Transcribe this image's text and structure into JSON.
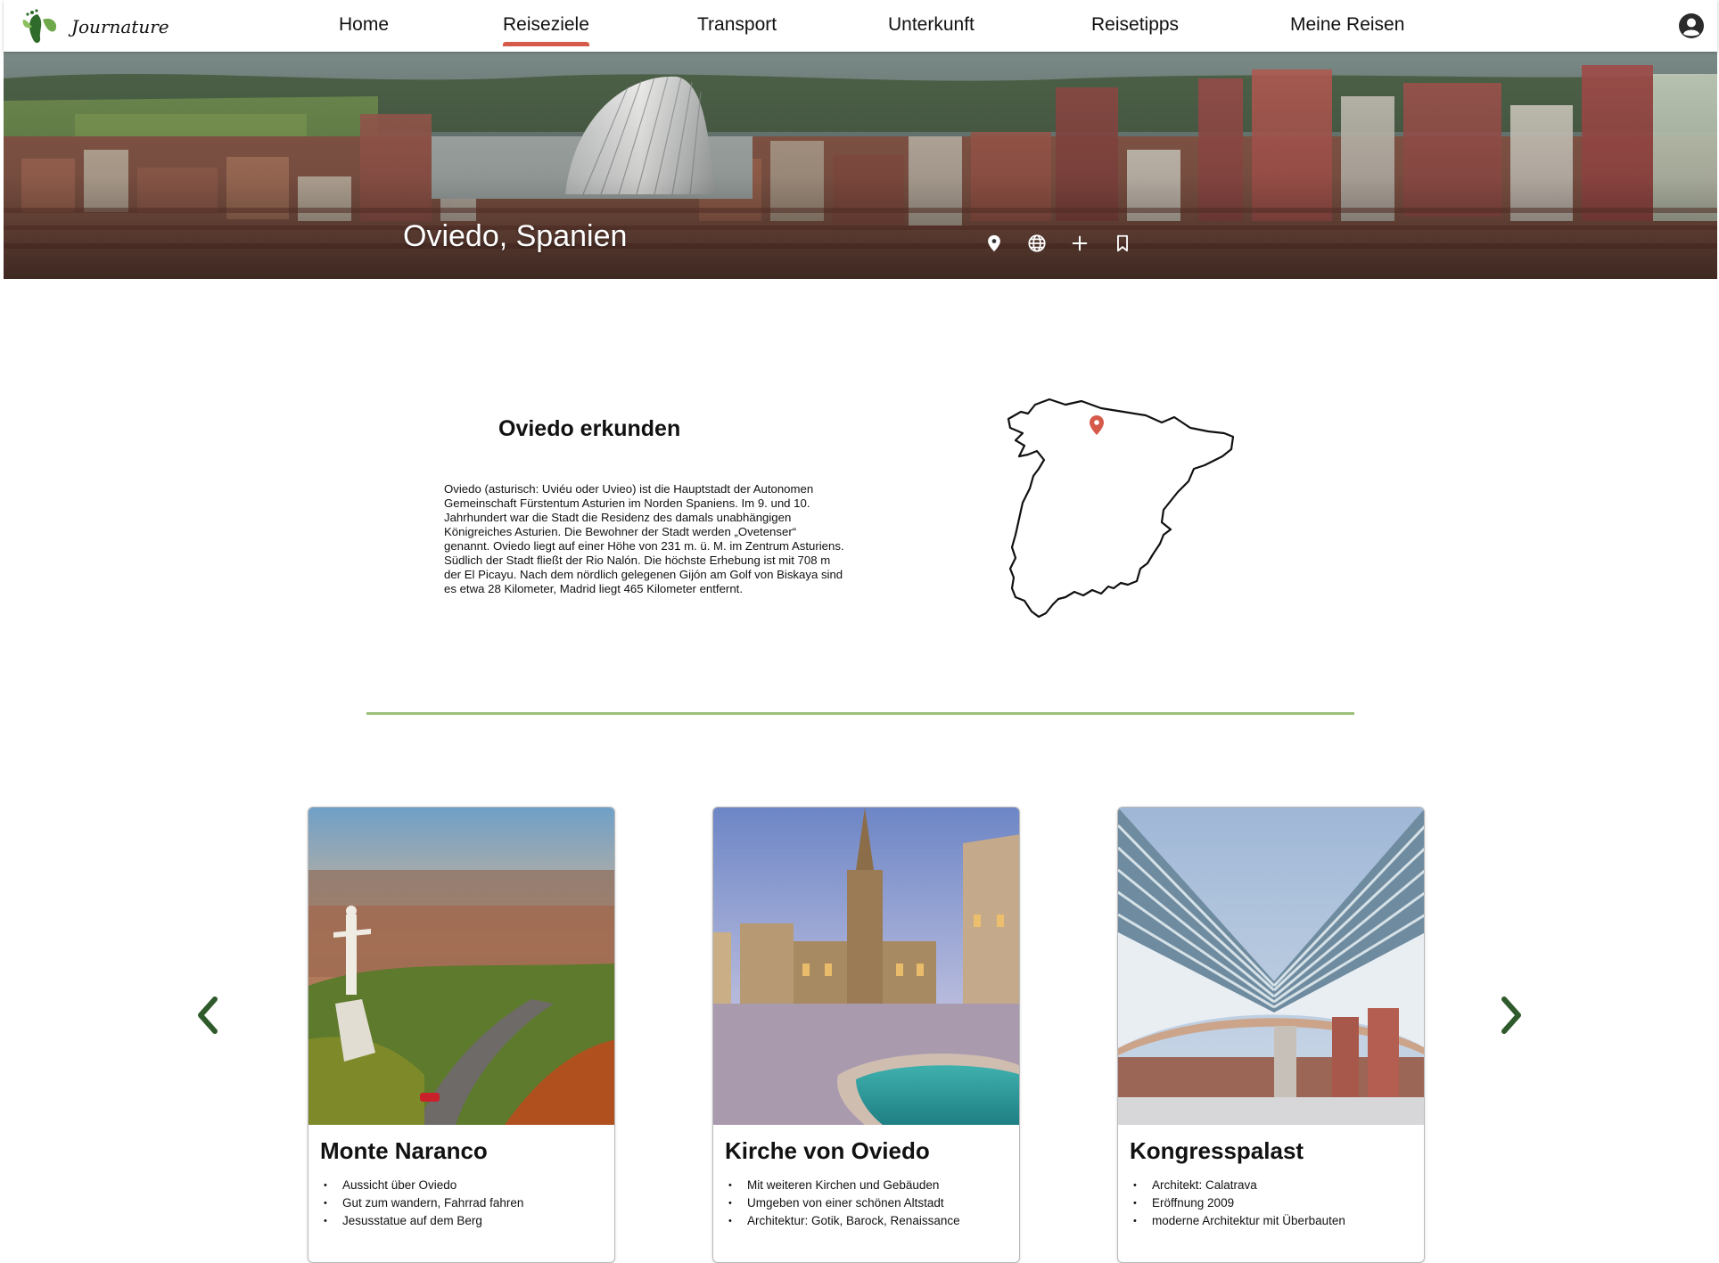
{
  "brand": {
    "name": "Journature",
    "logo_icon": "footprint-leaf-logo"
  },
  "nav": {
    "items": [
      {
        "label": "Home",
        "active": false
      },
      {
        "label": "Reiseziele",
        "active": true
      },
      {
        "label": "Transport",
        "active": false
      },
      {
        "label": "Unterkunft",
        "active": false
      },
      {
        "label": "Reisetipps",
        "active": false
      },
      {
        "label": "Meine Reisen",
        "active": false
      }
    ],
    "account_icon": "user-circle-icon",
    "active_color": "#d65a4a"
  },
  "hero": {
    "title": "Oviedo, Spanien",
    "icons": [
      "location-pin-icon",
      "globe-icon",
      "plus-icon",
      "bookmark-icon"
    ]
  },
  "explore": {
    "title": "Oviedo erkunden",
    "text": "Oviedo (asturisch: Uviéu oder Uvieo) ist die Hauptstadt der Autonomen Gemeinschaft Fürstentum Asturien im Norden Spaniens. Im 9. und 10. Jahrhundert war die Stadt die Residenz des damals unabhängigen Königreiches Asturien. Die Bewohner der Stadt werden „Ovetenser“ genannt. Oviedo liegt auf einer Höhe von 231 m. ü. M. im Zentrum Asturiens. Südlich der Stadt fließt der Rio Nalón. Die höchste Erhebung ist mit 708 m der El Picayu. Nach dem nördlich gelegenen Gijón am Golf von Biskaya sind es etwa 28 Kilometer, Madrid liegt 465 Kilometer entfernt.",
    "map_icon": "spain-outline-map",
    "pin_color": "#d65a4a",
    "divider_color": "#9cc07a"
  },
  "carousel": {
    "prev_icon": "chevron-left-icon",
    "next_icon": "chevron-right-icon",
    "arrow_color": "#2f5a2b",
    "cards": [
      {
        "title": "Monte Naranco",
        "bullets": [
          "Aussicht über Oviedo",
          "Gut zum wandern, Fahrrad fahren",
          "Jesusstatue auf dem Berg"
        ]
      },
      {
        "title": "Kirche von Oviedo",
        "bullets": [
          "Mit weiteren Kirchen und Gebäuden",
          "Umgeben von einer schönen Altstadt",
          "Architektur: Gotik, Barock, Renaissance"
        ]
      },
      {
        "title": "Kongresspalast",
        "bullets": [
          "Architekt: Calatrava",
          "Eröffnung 2009",
          "moderne Architektur mit Überbauten"
        ]
      }
    ]
  }
}
